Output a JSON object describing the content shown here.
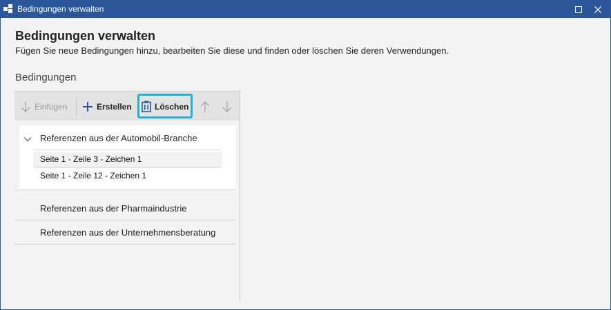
{
  "window": {
    "title": "Bedingungen verwalten"
  },
  "header": {
    "title": "Bedingungen verwalten",
    "description": "Fügen Sie neue Bedingungen hinzu, bearbeiten Sie diese und finden oder löschen Sie deren Verwendungen."
  },
  "section": {
    "title": "Bedingungen"
  },
  "toolbar": {
    "insert_label": "Einfügen",
    "create_label": "Erstellen",
    "delete_label": "Löschen",
    "icons": {
      "insert": "arrow-down-icon",
      "create": "plus-icon",
      "delete": "clipboard-trash-icon",
      "up": "arrow-up-icon",
      "down": "arrow-down-icon"
    }
  },
  "groups": [
    {
      "label": "Referenzen aus der Automobil-Branche",
      "expanded": true,
      "items": [
        {
          "label": "Seite 1 - Zeile 3 - Zeichen 1",
          "selected": true
        },
        {
          "label": "Seite 1 - Zeile 12 - Zeichen 1",
          "selected": false
        }
      ]
    },
    {
      "label": "Referenzen aus der Pharmaindustrie",
      "expanded": false
    },
    {
      "label": "Referenzen aus der Unternehmensberatung",
      "expanded": false
    }
  ],
  "colors": {
    "titlebar": "#2b579a",
    "highlight": "#1fb3d6",
    "toolbar": "#e3e3e3"
  }
}
